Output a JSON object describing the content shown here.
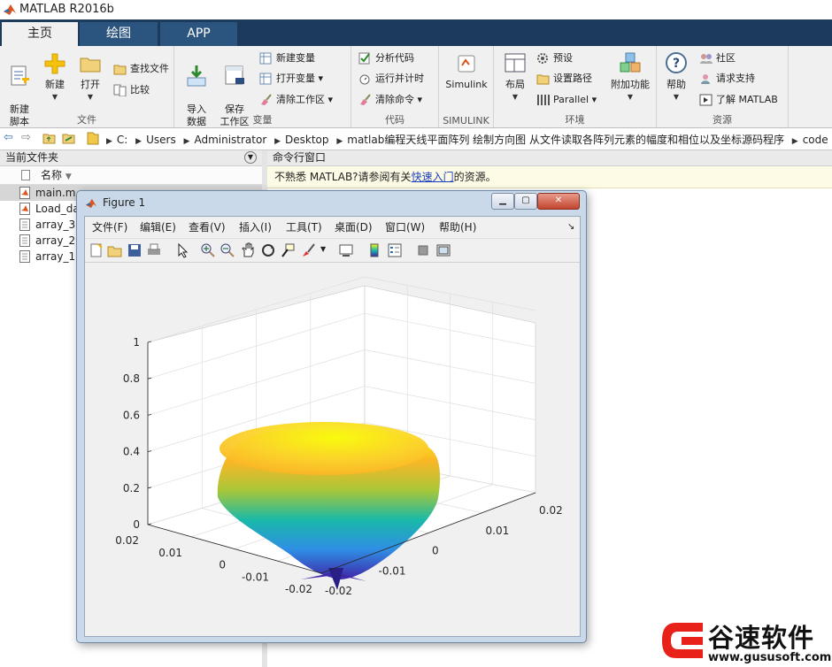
{
  "window": {
    "title": "MATLAB R2016b"
  },
  "tabs": [
    {
      "label": "主页",
      "active": true
    },
    {
      "label": "绘图",
      "active": false
    },
    {
      "label": "APP",
      "active": false
    }
  ],
  "ribbon": {
    "file": {
      "title": "文件",
      "new_script": "新建\n脚本",
      "new": "新建",
      "open": "打开",
      "find_files": "查找文件",
      "compare": "比较"
    },
    "variable": {
      "title": "变量",
      "import": "导入\n数据",
      "save_ws": "保存\n工作区",
      "new_var": "新建变量",
      "open_var": "打开变量",
      "clear_ws": "清除工作区"
    },
    "code": {
      "title": "代码",
      "analyze": "分析代码",
      "run_time": "运行并计时",
      "clear_cmd": "清除命令"
    },
    "simulink": {
      "title": "SIMULINK",
      "label": "Simulink"
    },
    "env": {
      "title": "环境",
      "layout": "布局",
      "prefs": "预设",
      "set_path": "设置路径",
      "parallel": "Parallel",
      "addons": "附加功能"
    },
    "resources": {
      "title": "资源",
      "help": "帮助",
      "community": "社区",
      "support": "请求支持",
      "learn": "了解 MATLAB"
    }
  },
  "address": {
    "crumbs": [
      "C:",
      "Users",
      "Administrator",
      "Desktop",
      "matlab编程天线平面阵列 绘制方向图 从文件读取各阵列元素的幅度和相位以及坐标源码程序",
      "code"
    ]
  },
  "current_folder": {
    "title": "当前文件夹",
    "col_name": "名称",
    "files": [
      {
        "name": "main.m",
        "selected": true
      },
      {
        "name": "Load_da",
        "selected": false
      },
      {
        "name": "array_3",
        "selected": false
      },
      {
        "name": "array_2",
        "selected": false
      },
      {
        "name": "array_1",
        "selected": false
      }
    ]
  },
  "command_window": {
    "title": "命令行窗口",
    "notice_pre": "不熟悉 MATLAB?请参阅有关",
    "notice_link": "快速入门",
    "notice_post": "的资源。"
  },
  "figure": {
    "title": "Figure 1",
    "menu": [
      "文件(F)",
      "编辑(E)",
      "查看(V)",
      "插入(I)",
      "工具(T)",
      "桌面(D)",
      "窗口(W)",
      "帮助(H)"
    ],
    "menu_arrow": "↘"
  },
  "chart_data": {
    "type": "surface",
    "z_ticks": [
      "0",
      "0.2",
      "0.4",
      "0.6",
      "0.8",
      "1"
    ],
    "x_ticks": [
      "0.02",
      "0.01",
      "0",
      "-0.01",
      "-0.02"
    ],
    "y_ticks": [
      "-0.02",
      "-0.01",
      "0",
      "0.01",
      "0.02"
    ],
    "zlim": [
      0,
      1
    ],
    "xlim": [
      -0.02,
      0.02
    ],
    "ylim": [
      -0.02,
      0.02
    ],
    "colormap": [
      "#3e26a8",
      "#2f8ee4",
      "#19b9a9",
      "#a9c738",
      "#fbb626",
      "#f9fb0e"
    ],
    "grid": true
  },
  "watermark": {
    "name": "谷速软件",
    "url": "www.gususoft.com"
  }
}
